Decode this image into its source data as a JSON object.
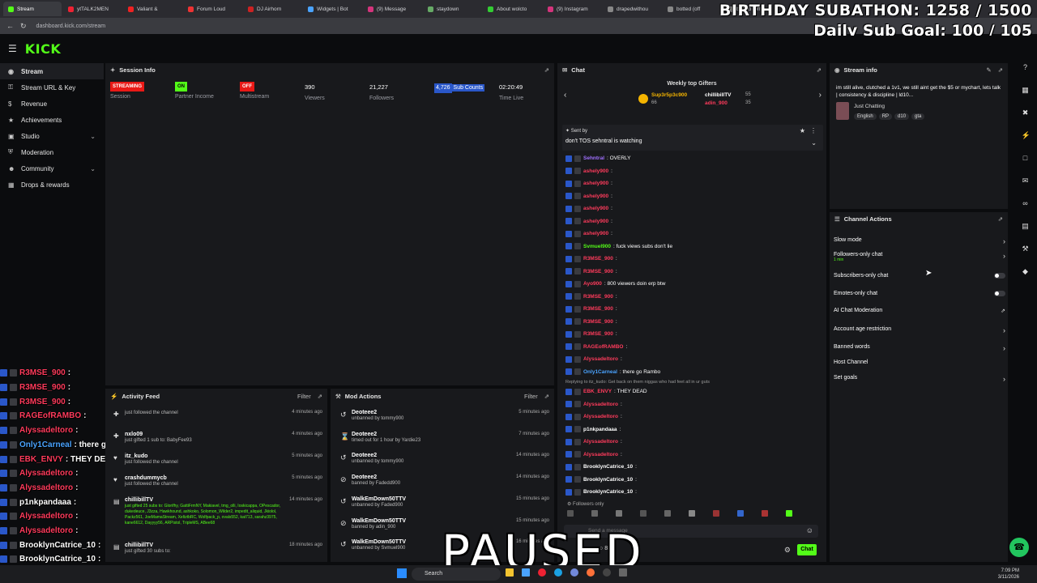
{
  "browser": {
    "tabs": [
      {
        "label": "Stream",
        "color": "#53fc18",
        "active": true
      },
      {
        "label": "ytTALK2MEN",
        "color": "#e23"
      },
      {
        "label": "Valiant &",
        "color": "#e22"
      },
      {
        "label": "Forum Loud",
        "color": "#e33"
      },
      {
        "label": "DJ Airhorn",
        "color": "#c22"
      },
      {
        "label": "Widgets | Bot",
        "color": "#4aa3ff"
      },
      {
        "label": "(9) Message",
        "color": "#d4347c"
      },
      {
        "label": "staydown",
        "color": "#6a6"
      },
      {
        "label": "About wolcto",
        "color": "#3c3"
      },
      {
        "label": "(9) Instagram",
        "color": "#d4347c"
      },
      {
        "label": "drapedwithou",
        "color": "#888"
      },
      {
        "label": "botted (off",
        "color": "#888"
      },
      {
        "label": "botted (off",
        "color": "#888"
      }
    ],
    "url": "dashboard.kick.com/stream"
  },
  "overlay": {
    "subathon": "BIRTHDAY SUBATHON: 1258 / 1500",
    "daily_goal": "Daily Sub Goal: 100 / 105"
  },
  "brand": {
    "logo": "KICK",
    "accent": "#53fc18"
  },
  "sidebar": {
    "items": [
      {
        "label": "Stream",
        "icon": "broadcast-icon"
      },
      {
        "label": "Stream URL & Key",
        "icon": "key-icon"
      },
      {
        "label": "Revenue",
        "icon": "dollar-icon"
      },
      {
        "label": "Achievements",
        "icon": "trophy-icon"
      },
      {
        "label": "Studio",
        "icon": "studio-icon"
      },
      {
        "label": "Moderation",
        "icon": "shield-icon"
      },
      {
        "label": "Community",
        "icon": "people-icon"
      },
      {
        "label": "Drops & rewards",
        "icon": "gift-icon"
      }
    ]
  },
  "session": {
    "title": "Session Info",
    "stats": [
      {
        "value": "STREAMING",
        "label": "Session"
      },
      {
        "value": "ON",
        "label": "Partner Income"
      },
      {
        "value": "OFF",
        "label": "Multistream"
      },
      {
        "value": "390",
        "label": "Viewers"
      },
      {
        "value": "21,227",
        "label": "Followers"
      },
      {
        "value": "4,726",
        "label": "Sub Counts"
      },
      {
        "value": "02:20:49",
        "label": "Time Live"
      }
    ]
  },
  "activity": {
    "title": "Activity Feed",
    "filter": "Filter",
    "items": [
      {
        "name": "",
        "desc": "just followed the channel",
        "time": "4 minutes ago"
      },
      {
        "name": "nxlo09",
        "desc": "just gifted 1 sub to: BabyFee93",
        "time": "4 minutes ago"
      },
      {
        "name": "itz_kudo",
        "desc": "just followed the channel",
        "time": "5 minutes ago"
      },
      {
        "name": "crashdummycb",
        "desc": "just followed the channel",
        "time": "5 minutes ago"
      },
      {
        "name": "chillibillTV",
        "desc": "just gifted 25 subs to: Glorifhy, GattiFrmNY, Makiavel, tmg_olli, Ioskicappa, OPescador, dukedeuce, J3zza, Hawkhound, ashkoko, Solomon_Wilder2, impedit_aliquid, Jkiolol, Packz561, JoeMamaStream, XeltztbRC, Wolfpack_p, ovals552, kat713, sarahz3975, kane6612, Dayyyy56, ARPistol, TripleMS, ABee68",
        "time": "14 minutes ago"
      },
      {
        "name": "chillibillTV",
        "desc": "just gifted 30 subs to:",
        "time": "18 minutes ago"
      }
    ]
  },
  "mod": {
    "title": "Mod Actions",
    "filter": "Filter",
    "items": [
      {
        "name": "Deoteee2",
        "desc": "unbanned by tommy900",
        "time": "5 minutes ago"
      },
      {
        "name": "Deoteee2",
        "desc": "timed out for 1 hour by Yardie23",
        "time": "7 minutes ago"
      },
      {
        "name": "Deoteee2",
        "desc": "unbanned by tommy900",
        "time": "14 minutes ago"
      },
      {
        "name": "Deoteee2",
        "desc": "banned by Fadedd900",
        "time": "14 minutes ago"
      },
      {
        "name": "WalkEmDown50TTV",
        "desc": "unbanned by Faded900",
        "time": "15 minutes ago"
      },
      {
        "name": "WalkEmDown50TTV",
        "desc": "banned by adin_900",
        "time": "15 minutes ago"
      },
      {
        "name": "WalkEmDown50TTV",
        "desc": "unbanned by Svmuel900",
        "time": "16 minutes ago"
      }
    ]
  },
  "chat": {
    "title": "Chat",
    "gifters_title": "Weekly top Gifters",
    "gifters": [
      {
        "name": "Sup3r5p3c900",
        "count": "66"
      },
      {
        "name": "chillibillTV",
        "count": "55"
      },
      {
        "name": "adin_900",
        "count": "35"
      }
    ],
    "pinned_label": "Sent by",
    "pinned_msg": "don't TOS sehntral is watching",
    "messages": [
      {
        "user": "Sehntral",
        "text": ": OVERLY",
        "color": "#a070ff"
      },
      {
        "user": "ashely900",
        "text": ":",
        "color": "#ff3b5c"
      },
      {
        "user": "ashely900",
        "text": ":",
        "color": "#ff3b5c"
      },
      {
        "user": "ashely900",
        "text": ":",
        "color": "#ff3b5c"
      },
      {
        "user": "ashely900",
        "text": ":",
        "color": "#ff3b5c"
      },
      {
        "user": "ashely900",
        "text": ":",
        "color": "#ff3b5c"
      },
      {
        "user": "ashely900",
        "text": ":",
        "color": "#ff3b5c"
      },
      {
        "user": "Svmuel900",
        "text": ": fuck views subs don't lie",
        "color": "#53fc18"
      },
      {
        "user": "R3MSE_900",
        "text": ":",
        "color": "#ff3b5c"
      },
      {
        "user": "R3MSE_900",
        "text": ":",
        "color": "#ff3b5c"
      },
      {
        "user": "Ayo900",
        "text": ": 800 viewers doin erp btw",
        "color": "#ff3b5c"
      },
      {
        "user": "R3MSE_900",
        "text": ":",
        "color": "#ff3b5c"
      },
      {
        "user": "R3MSE_900",
        "text": ":",
        "color": "#ff3b5c"
      },
      {
        "user": "R3MSE_900",
        "text": ":",
        "color": "#ff3b5c"
      },
      {
        "user": "R3MSE_900",
        "text": ":",
        "color": "#ff3b5c"
      },
      {
        "user": "RAGEofRAMBO",
        "text": ":",
        "color": "#ff3b5c"
      },
      {
        "user": "Alyssadeltoro",
        "text": ":",
        "color": "#ff3b5c"
      },
      {
        "user": "Only1Carneal",
        "text": ": there go Rambo",
        "color": "#4aa3ff"
      },
      {
        "user": "EBK_ENVY",
        "text": ": THEY DEAD",
        "color": "#ff3b5c",
        "reply": "Replying to itz_kudo: Get back on them niggas who had feet all in ur guts"
      },
      {
        "user": "Alyssadeltoro",
        "text": ":",
        "color": "#ff3b5c"
      },
      {
        "user": "Alyssadeltoro",
        "text": ":",
        "color": "#ff3b5c"
      },
      {
        "user": "p1nkpandaaa",
        "text": ":",
        "color": "#ffffff"
      },
      {
        "user": "Alyssadeltoro",
        "text": ":",
        "color": "#ff3b5c"
      },
      {
        "user": "Alyssadeltoro",
        "text": ":",
        "color": "#ff3b5c"
      },
      {
        "user": "BrooklynCatrice_10",
        "text": ":",
        "color": "#ffffff"
      },
      {
        "user": "BrooklynCatrice_10",
        "text": ":",
        "color": "#ffffff"
      },
      {
        "user": "BrooklynCatrice_10",
        "text": ":",
        "color": "#ffffff"
      }
    ],
    "followers_only": "Followers only",
    "input_placeholder": "Send a message",
    "points": "88",
    "send_label": "Chat"
  },
  "stream_info": {
    "title": "Stream info",
    "text": "im still alive, clutched a 1v1, we still aint get the $5 or mychart, lets talk | consistency & discipline | ld10...",
    "category": "Just Chatting",
    "tags": [
      "English",
      "RP",
      "d10",
      "gta"
    ]
  },
  "channel_actions": {
    "title": "Channel Actions",
    "items": [
      {
        "label": "Slow mode",
        "kind": "arrow"
      },
      {
        "label": "Followers-only chat",
        "sub": "1 min",
        "kind": "arrow"
      },
      {
        "label": "Subscribers-only chat",
        "kind": "toggle"
      },
      {
        "label": "Emotes-only chat",
        "kind": "toggle"
      },
      {
        "label": "AI Chat Moderation",
        "kind": "link"
      },
      {
        "label": "Account age restriction",
        "kind": "arrow"
      },
      {
        "label": "Banned words",
        "kind": "arrow"
      },
      {
        "label": "Host Channel",
        "kind": "none"
      },
      {
        "label": "Set goals",
        "kind": "arrow"
      }
    ]
  },
  "left_chat": [
    {
      "user": "R3MSE_900",
      "text": ":",
      "color": "#ff3b5c"
    },
    {
      "user": "R3MSE_900",
      "text": ":",
      "color": "#ff3b5c"
    },
    {
      "user": "R3MSE_900",
      "text": ":",
      "color": "#ff3b5c"
    },
    {
      "user": "RAGEofRAMBO",
      "text": ":",
      "color": "#ff3b5c"
    },
    {
      "user": "Alyssadeltoro",
      "text": ":",
      "color": "#ff3b5c"
    },
    {
      "user": "Only1Carneal",
      "text": ": there go Rambo",
      "color": "#4aa3ff"
    },
    {
      "user": "EBK_ENVY",
      "text": ": THEY DEAD",
      "color": "#ff3b5c"
    },
    {
      "user": "Alyssadeltoro",
      "text": ":",
      "color": "#ff3b5c"
    },
    {
      "user": "Alyssadeltoro",
      "text": ":",
      "color": "#ff3b5c"
    },
    {
      "user": "p1nkpandaaa",
      "text": ":",
      "color": "#ffffff"
    },
    {
      "user": "Alyssadeltoro",
      "text": ":",
      "color": "#ff3b5c"
    },
    {
      "user": "Alyssadeltoro",
      "text": ":",
      "color": "#ff3b5c"
    },
    {
      "user": "BrooklynCatrice_10",
      "text": ":",
      "color": "#ffffff"
    },
    {
      "user": "BrooklynCatrice_10",
      "text": ":",
      "color": "#ffffff"
    },
    {
      "user": "BrooklynCatrice_10",
      "text": ":",
      "color": "#ffffff"
    }
  ],
  "paused": "PAUSED",
  "taskbar": {
    "search": "Search",
    "time": "7:09 PM",
    "date": "3/11/2026"
  }
}
